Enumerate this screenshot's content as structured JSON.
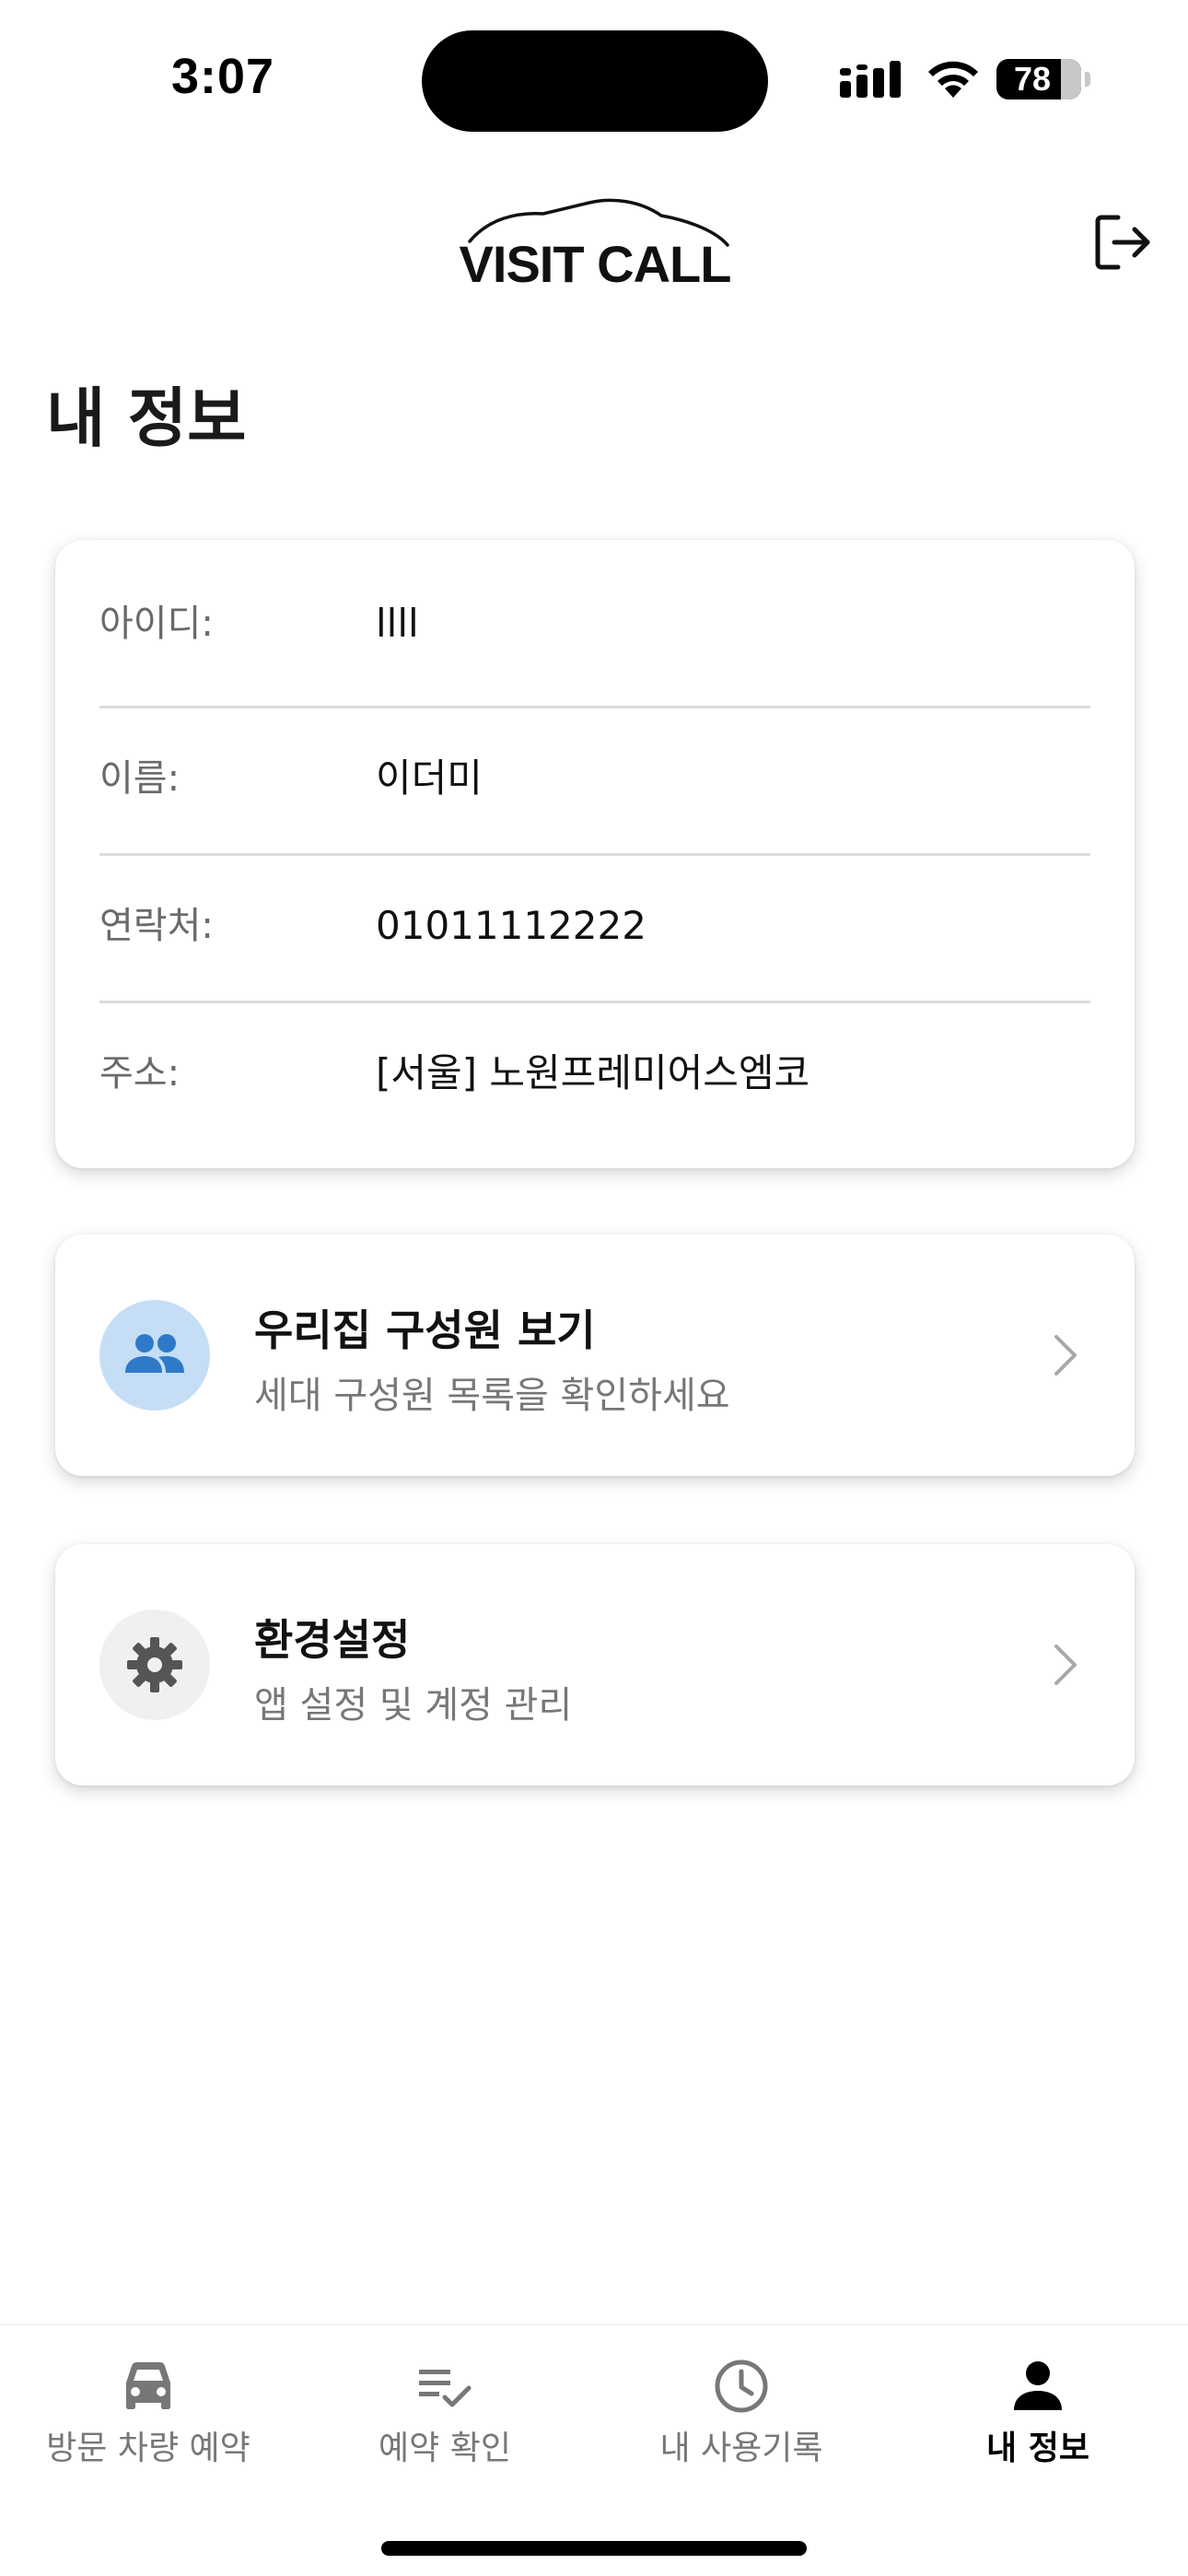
{
  "status_bar": {
    "time": "3:07",
    "battery_level": "78",
    "icons": [
      "signal-icon",
      "wifi-icon",
      "battery-icon"
    ]
  },
  "header": {
    "logo_text": "VISIT CALL",
    "logout_icon": "logout-icon"
  },
  "page": {
    "title": "내 정보"
  },
  "profile": {
    "rows": [
      {
        "label": "아이디:",
        "value": "llll"
      },
      {
        "label": "이름:",
        "value": "이더미"
      },
      {
        "label": "연락처:",
        "value": "01011112222"
      },
      {
        "label": "주소:",
        "value": "[서울] 노원프레미어스엠코"
      }
    ]
  },
  "menu": {
    "household": {
      "title": "우리집 구성원 보기",
      "subtitle": "세대 구성원 목록을 확인하세요",
      "icon": "people-icon",
      "icon_color": "#2f79c9",
      "icon_bg": "#c5def6"
    },
    "settings": {
      "title": "환경설정",
      "subtitle": "앱 설정 및 계정 관리",
      "icon": "gear-icon",
      "icon_color": "#555555",
      "icon_bg": "#f0f0f0"
    }
  },
  "bottom_nav": {
    "items": [
      {
        "label": "방문 차량 예약",
        "icon": "car-icon",
        "active": false
      },
      {
        "label": "예약 확인",
        "icon": "checklist-icon",
        "active": false
      },
      {
        "label": "내 사용기록",
        "icon": "clock-icon",
        "active": false
      },
      {
        "label": "내 정보",
        "icon": "person-icon",
        "active": true
      }
    ],
    "active_color": "#000000",
    "inactive_color": "#777777"
  }
}
